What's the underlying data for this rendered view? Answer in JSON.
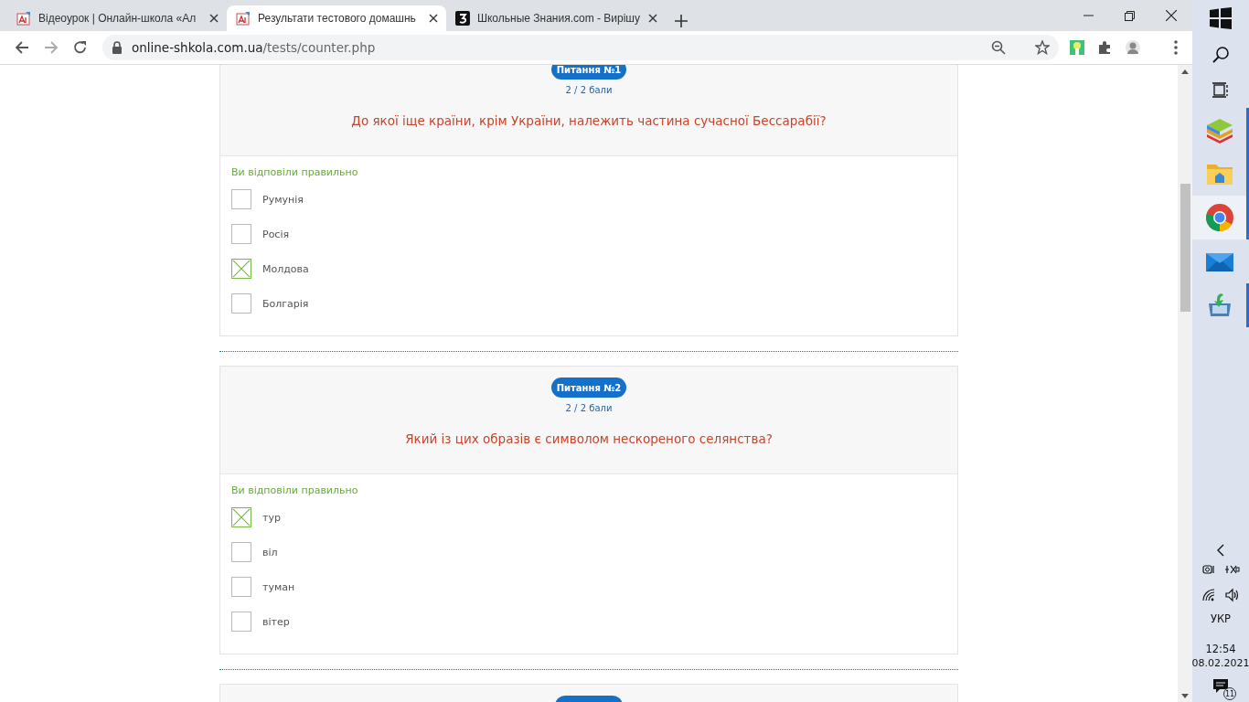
{
  "browser": {
    "tabs": [
      {
        "title": "Відеоурок | Онлайн-школа «Ал",
        "selected": false,
        "kind": "school"
      },
      {
        "title": "Результати тестового домашнь",
        "selected": true,
        "kind": "school"
      },
      {
        "title": "Школьные Знания.com - Вирішу",
        "selected": false,
        "kind": "znania"
      }
    ],
    "address": {
      "host": "online-shkola.com.ua",
      "path": "/tests/counter.php"
    }
  },
  "questions": [
    {
      "badge": "Питання №1",
      "score": "2 / 2 бали",
      "question": "До якої іще країни, крім України, належить частина сучасної Бессарабії?",
      "result": "Ви відповіли правильно",
      "options": [
        {
          "label": "Румунія",
          "checked": false
        },
        {
          "label": "Росія",
          "checked": false
        },
        {
          "label": "Молдова",
          "checked": true
        },
        {
          "label": "Болгарія",
          "checked": false
        }
      ]
    },
    {
      "badge": "Питання №2",
      "score": "2 / 2 бали",
      "question": "Який із цих образів є символом нескореного селянства?",
      "result": "Ви відповіли правильно",
      "options": [
        {
          "label": "тур",
          "checked": true
        },
        {
          "label": "віл",
          "checked": false
        },
        {
          "label": "туман",
          "checked": false
        },
        {
          "label": "вітер",
          "checked": false
        }
      ]
    },
    {
      "kind": "cut"
    }
  ],
  "taskbar": {
    "language": "УКР",
    "time": "12:54",
    "date": "08.02.2021",
    "notifications": "11"
  }
}
